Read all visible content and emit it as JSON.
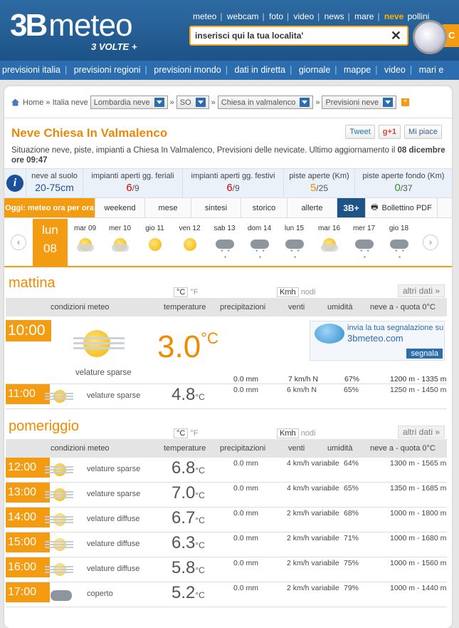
{
  "header": {
    "logo_b": "3B",
    "logo_m": "meteo",
    "slogan": "3 VOLTE +",
    "links": [
      "meteo",
      "webcam",
      "foto",
      "video",
      "news",
      "mare",
      "neve",
      "pollini"
    ],
    "search_placeholder": "inserisci qui la tua localita'",
    "search_tab": "C"
  },
  "nav": [
    "previsioni italia",
    "previsioni regioni",
    "previsioni mondo",
    "dati in diretta",
    "giornale",
    "mappe",
    "video",
    "mari e"
  ],
  "breadcrumb": {
    "home": "Home",
    "italia": "Italia neve",
    "dd1": "Lombardia neve",
    "dd2": "SO",
    "dd3": "Chiesa in valmalenco",
    "dd4": "Previsioni neve"
  },
  "title": "Neve Chiesa In Valmalenco",
  "social": {
    "tweet": "Tweet",
    "gplus": "g+1",
    "fb": "Mi piace"
  },
  "description": "Situazione neve, piste, impianti a Chiesa In Valmalenco, Previsioni delle nevicate. Ultimo aggiornamento il ",
  "description_date": "08 dicembre ore 09:47",
  "stats": {
    "neve_label": "neve al suolo",
    "neve_value": "20-75cm",
    "feriali_label": "impianti aperti gg. feriali",
    "feriali_a": "6",
    "feriali_b": "/9",
    "festivi_label": "impianti aperti gg. festivi",
    "festivi_a": "6",
    "festivi_b": "/9",
    "piste_label": "piste aperte (Km)",
    "piste_a": "5",
    "piste_b": "/25",
    "fondo_label": "piste aperte fondo (Km)",
    "fondo_a": "0",
    "fondo_b": "/37"
  },
  "tabs": [
    "Oggi: meteo ora per ora",
    "weekend",
    "mese",
    "sintesi",
    "storico",
    "allerte",
    "3B+",
    "Bollettino PDF"
  ],
  "days": [
    {
      "name": "lun",
      "num": "08",
      "icon": "selected"
    },
    {
      "name": "mar 09",
      "icon": "sun-cloud"
    },
    {
      "name": "mer 10",
      "icon": "sun-cloud"
    },
    {
      "name": "gio 11",
      "icon": "sun"
    },
    {
      "name": "ven 12",
      "icon": "sun"
    },
    {
      "name": "sab 13",
      "icon": "snow"
    },
    {
      "name": "dom 14",
      "icon": "snow"
    },
    {
      "name": "lun 15",
      "icon": "snow"
    },
    {
      "name": "mar 16",
      "icon": "sun-cloud"
    },
    {
      "name": "mer 17",
      "icon": "snow"
    },
    {
      "name": "gio 18",
      "icon": "snow"
    }
  ],
  "columns": {
    "cond": "condizioni meteo",
    "temp": "temperature",
    "prec": "precipitazioni",
    "venti": "venti",
    "umid": "umidità",
    "quota": "neve a - quota 0°C"
  },
  "units": {
    "c": "°C",
    "f": "°F",
    "kmh": "Kmh",
    "nodi": "nodi",
    "altri": "altri dati »"
  },
  "mattina": {
    "title": "mattina",
    "now": {
      "time": "10:00",
      "cond": "velature sparse",
      "temp": "3.0",
      "deg": "°C",
      "mm": "0.0 mm",
      "km": "7 km/h  N",
      "um": "67%",
      "q": "1200 m - 1335 m"
    },
    "rows": [
      {
        "time": "11:00",
        "cond": "velature sparse",
        "temp": "4.8",
        "mm": "0.0 mm",
        "km": "6 km/h  N",
        "um": "65%",
        "q": "1250 m - 1450 m"
      }
    ]
  },
  "segnala": {
    "line1": "invia la tua segnalazione su",
    "line2": "3bmeteo.com",
    "btn": "segnala"
  },
  "pomeriggio": {
    "title": "pomeriggio",
    "rows": [
      {
        "time": "12:00",
        "cond": "velature sparse",
        "temp": "6.8",
        "mm": "0.0 mm",
        "km": "4 km/h  variabile",
        "um": "64%",
        "q": "1300 m - 1565 m"
      },
      {
        "time": "13:00",
        "cond": "velature sparse",
        "temp": "7.0",
        "mm": "0.0 mm",
        "km": "4 km/h  variabile",
        "um": "65%",
        "q": "1350 m - 1685 m"
      },
      {
        "time": "14:00",
        "cond": "velature diffuse",
        "temp": "6.7",
        "mm": "0.0 mm",
        "km": "2 km/h  variabile",
        "um": "68%",
        "q": "1000 m - 1800 m"
      },
      {
        "time": "15:00",
        "cond": "velature diffuse",
        "temp": "6.3",
        "mm": "0.0 mm",
        "km": "2 km/h  variabile",
        "um": "71%",
        "q": "1000 m - 1680 m"
      },
      {
        "time": "16:00",
        "cond": "velature diffuse",
        "temp": "5.8",
        "mm": "0.0 mm",
        "km": "2 km/h  variabile",
        "um": "75%",
        "q": "1000 m - 1560 m"
      },
      {
        "time": "17:00",
        "cond": "coperto",
        "temp": "5.2",
        "mm": "0.0 mm",
        "km": "2 km/h  variabile",
        "um": "79%",
        "q": "1000 m - 1440 m"
      }
    ]
  }
}
